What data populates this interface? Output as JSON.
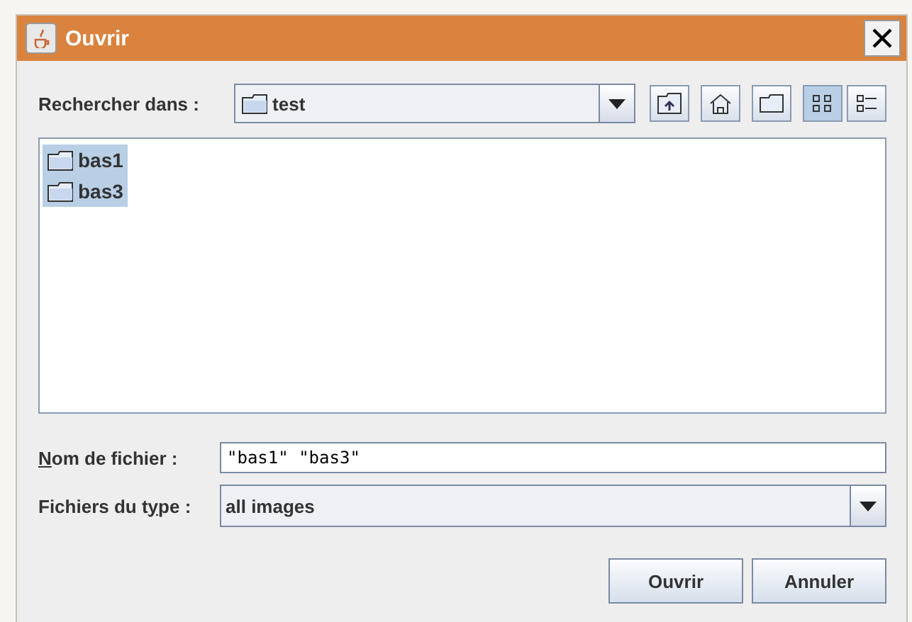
{
  "window": {
    "title": "Ouvrir"
  },
  "look_in": {
    "label": "Rechercher dans :",
    "value": "test"
  },
  "toolbar": [
    {
      "kind": "up",
      "selected": false
    },
    {
      "kind": "home",
      "selected": false
    },
    {
      "kind": "newfolder",
      "selected": false
    },
    {
      "kind": "list",
      "selected": true
    },
    {
      "kind": "details",
      "selected": false
    }
  ],
  "files": [
    {
      "name": "bas1",
      "selected": true
    },
    {
      "name": "bas3",
      "selected": true
    }
  ],
  "file_name": {
    "label": {
      "key": "N",
      "post": "om de fichier :"
    },
    "value": "\"bas1\" \"bas3\""
  },
  "file_type": {
    "label": {
      "pre": "Fichiers du t",
      "key": "y",
      "post": "pe :"
    },
    "value": "all images"
  },
  "buttons": [
    "Ouvrir",
    "Annuler"
  ]
}
